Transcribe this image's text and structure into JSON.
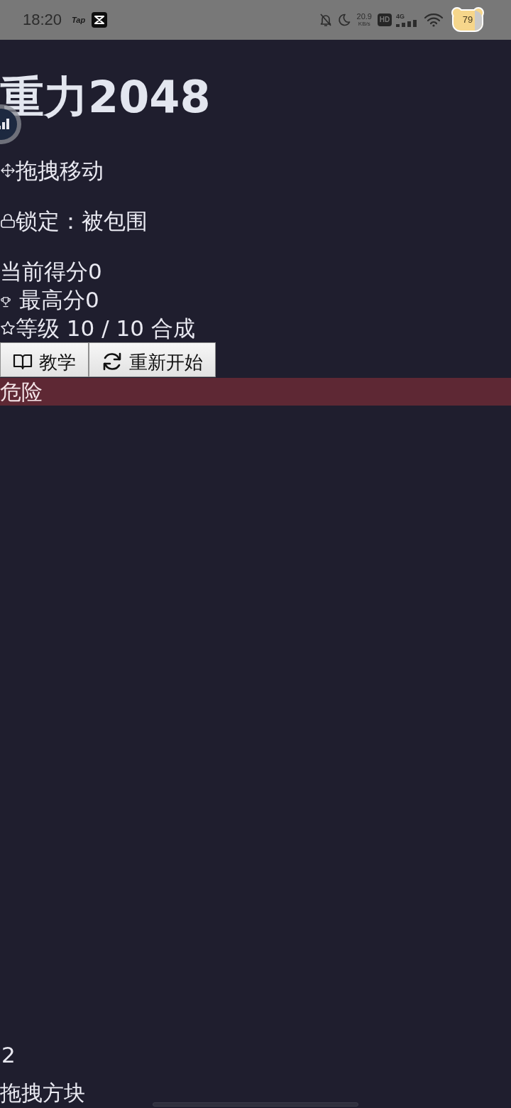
{
  "status_bar": {
    "time": "18:20",
    "app_label": "Tap",
    "network_speed": "20.9",
    "network_speed_unit": "KB/s",
    "hd_label": "HD",
    "network_type": "4G",
    "battery": "79"
  },
  "title": "重力2048",
  "info_lines": [
    {
      "kind": "move",
      "text": "拖拽移动"
    },
    {
      "kind": "lock",
      "text": "锁定：被包围"
    }
  ],
  "stats": [
    {
      "kind": "plain",
      "text": "当前得分0"
    },
    {
      "kind": "trophy",
      "text": "最高分0"
    },
    {
      "kind": "star",
      "text": "等级 10 / 10 合成"
    }
  ],
  "buttons": [
    {
      "kind": "book",
      "label": "教学"
    },
    {
      "kind": "refresh",
      "label": "重新开始"
    }
  ],
  "warning_banner": {
    "text": "危险"
  },
  "tile_value": "2",
  "hint": "拖拽方块"
}
